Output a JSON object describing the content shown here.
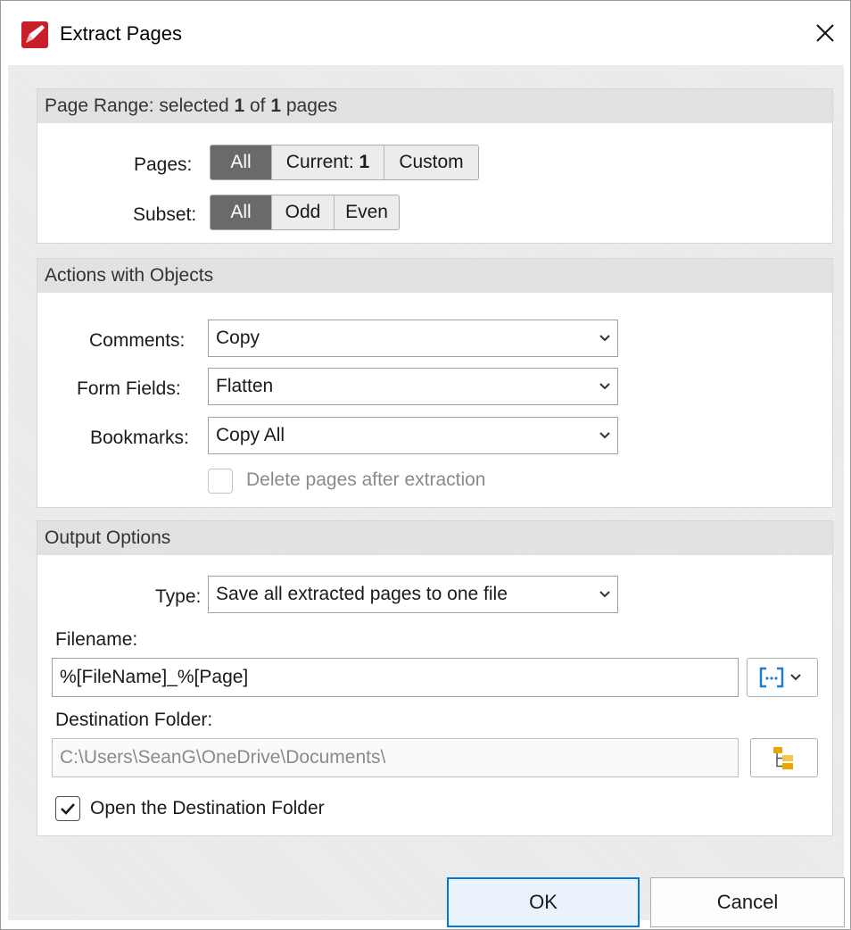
{
  "window": {
    "title": "Extract Pages"
  },
  "page_range": {
    "header_prefix": "Page Range: selected ",
    "selected_count": "1",
    "of_text": " of ",
    "total_count": "1",
    "pages_text": " pages",
    "pages_label": "Pages:",
    "pages_options": {
      "all": "All",
      "current_prefix": "Current: ",
      "current_value": "1",
      "custom": "Custom"
    },
    "pages_selected": "All",
    "subset_label": "Subset:",
    "subset_options": {
      "all": "All",
      "odd": "Odd",
      "even": "Even"
    },
    "subset_selected": "All"
  },
  "actions": {
    "header": "Actions with Objects",
    "comments_label": "Comments:",
    "comments_value": "Copy",
    "form_fields_label": "Form Fields:",
    "form_fields_value": "Flatten",
    "bookmarks_label": "Bookmarks:",
    "bookmarks_value": "Copy All",
    "delete_pages_label": "Delete pages after extraction",
    "delete_pages_checked": false
  },
  "output": {
    "header": "Output Options",
    "type_label": "Type:",
    "type_value": "Save all extracted pages to one file",
    "filename_label": "Filename:",
    "filename_value": "%[FileName]_%[Page]",
    "destination_label": "Destination Folder:",
    "destination_value": "C:\\Users\\SeanG\\OneDrive\\Documents\\",
    "open_destination_label": "Open the Destination Folder",
    "open_destination_checked": true
  },
  "buttons": {
    "ok": "OK",
    "cancel": "Cancel"
  },
  "colors": {
    "accent": "#0078d7",
    "segment_active": "#6a6a6a",
    "macro_icon": "#1e7fd0",
    "folder_icon": "#e8a800"
  }
}
